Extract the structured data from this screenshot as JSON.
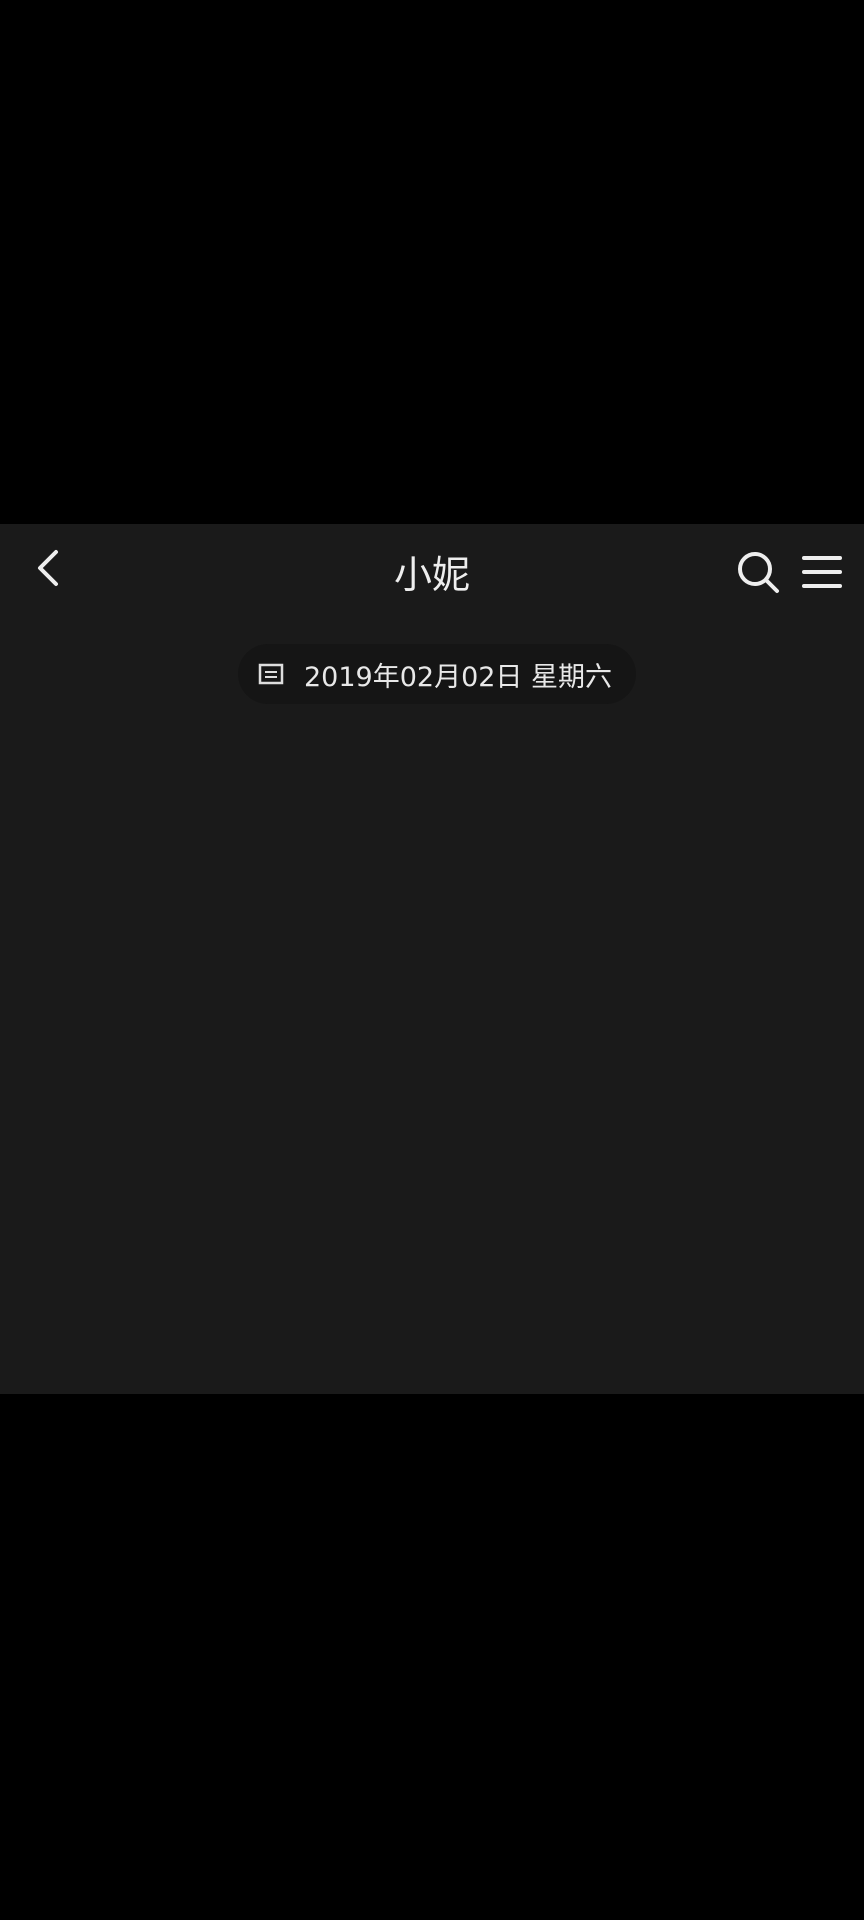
{
  "header": {
    "title": "小妮",
    "back_icon": "chevron-left-icon",
    "search_icon": "search-icon",
    "menu_icon": "hamburger-menu-icon"
  },
  "date_label": {
    "icon": "calendar-icon",
    "text": "2019年02月02日 星期六"
  },
  "colors": {
    "background": "#1a1a1a",
    "letterbox": "#000000",
    "text": "#eeeeee"
  }
}
